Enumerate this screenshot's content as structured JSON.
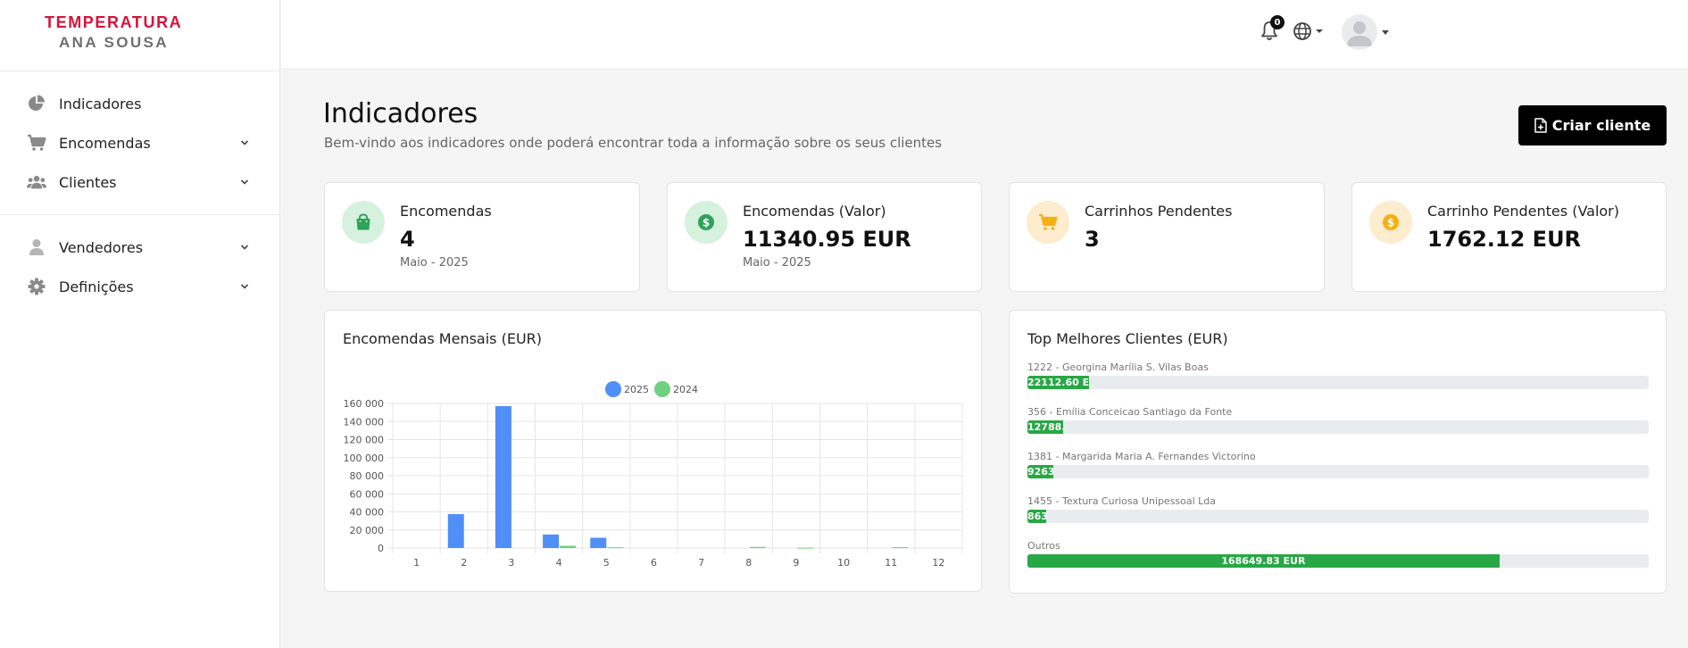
{
  "brand": {
    "line1": "TEMPERATURA",
    "line2": "ANA SOUSA"
  },
  "sidebar": {
    "items": [
      {
        "label": "Indicadores",
        "icon": "chart-pie-icon"
      },
      {
        "label": "Encomendas",
        "icon": "cart-icon"
      },
      {
        "label": "Clientes",
        "icon": "users-icon"
      },
      {
        "label": "Vendedores",
        "icon": "user-icon"
      },
      {
        "label": "Definições",
        "icon": "gear-icon"
      }
    ]
  },
  "topbar": {
    "notifications_count": "0"
  },
  "header": {
    "title": "Indicadores",
    "subtitle": "Bem-vindo aos indicadores onde poderá encontrar toda a informação sobre os seus clientes",
    "create_button": "Criar cliente"
  },
  "kpis": [
    {
      "label": "Encomendas",
      "value": "4",
      "period": "Maio - 2025",
      "icon": "shopping-bag-icon",
      "color": "#2fa35a",
      "bg": "#d6f1de"
    },
    {
      "label": "Encomendas (Valor)",
      "value": "11340.95 EUR",
      "period": "Maio - 2025",
      "icon": "dollar-circle-icon",
      "color": "#2fa35a",
      "bg": "#d6f1de"
    },
    {
      "label": "Carrinhos Pendentes",
      "value": "3",
      "period": "",
      "icon": "cart-icon",
      "color": "#f5b014",
      "bg": "#fdeccd"
    },
    {
      "label": "Carrinho Pendentes (Valor)",
      "value": "1762.12 EUR",
      "period": "",
      "icon": "dollar-circle-icon",
      "color": "#f5b014",
      "bg": "#fdeccd"
    }
  ],
  "chart_card": {
    "title": "Encomendas Mensais (EUR)"
  },
  "chart_data": {
    "type": "bar",
    "categories": [
      "1",
      "2",
      "3",
      "4",
      "5",
      "6",
      "7",
      "8",
      "9",
      "10",
      "11",
      "12"
    ],
    "series": [
      {
        "name": "2025",
        "color": "#4f8ff7",
        "values": [
          0,
          37500,
          157000,
          15000,
          11340.95,
          0,
          0,
          0,
          0,
          0,
          0,
          0
        ]
      },
      {
        "name": "2024",
        "color": "#6fd07f",
        "values": [
          0,
          0,
          0,
          2500,
          800,
          0,
          0,
          1200,
          400,
          0,
          900,
          0
        ]
      }
    ],
    "ylim": [
      0,
      160000
    ],
    "yticks": [
      "0",
      "20 000",
      "40 000",
      "60 000",
      "80 000",
      "100 000",
      "120 000",
      "140 000",
      "160 000"
    ],
    "grid": true,
    "legend_position": "top-center"
  },
  "clients_card": {
    "title": "Top Melhores Clientes (EUR)",
    "clients": [
      {
        "name": "1222 - Georgina Marília S. Vilas Boas",
        "value_label": "22112.60 EUR",
        "value": 22112.6
      },
      {
        "name": "356 - Emília Conceicao Santiago da Fonte",
        "value_label": "12788.",
        "value": 12788
      },
      {
        "name": "1381 - Margarida Maria A. Fernandes Victorino",
        "value_label": "9263",
        "value": 9263
      },
      {
        "name": "1455 - Textura Curiosa Unipessoal Lda",
        "value_label": "863",
        "value": 6700
      },
      {
        "name": "Outros",
        "value_label": "168649.83 EUR",
        "value": 168649.83
      }
    ],
    "scale_max": 222000
  }
}
